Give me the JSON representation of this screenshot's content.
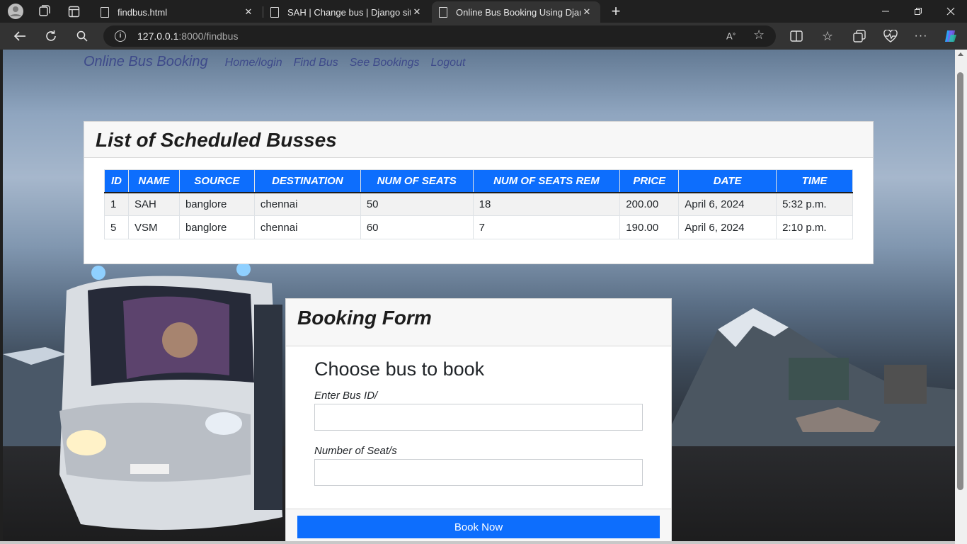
{
  "browser": {
    "tabs": [
      {
        "title": "findbus.html",
        "active": false
      },
      {
        "title": "SAH | Change bus | Django site admin",
        "active": false
      },
      {
        "title": "Online Bus Booking Using Django",
        "active": true
      }
    ],
    "new_tab_symbol": "+",
    "url_host": "127.0.0.1",
    "url_rest": ":8000/findbus",
    "icons": [
      "profile-icon",
      "workspaces-icon",
      "tab-actions-icon",
      "back-icon",
      "refresh-icon",
      "search-icon",
      "site-info-icon",
      "read-aloud-icon",
      "favorite-icon",
      "split-screen-icon",
      "favorites-icon",
      "collections-icon",
      "browser-essentials-icon",
      "more-icon",
      "copilot-icon"
    ]
  },
  "site": {
    "brand": "Online Bus Booking",
    "nav": [
      "Home/login",
      "Find Bus",
      "See Bookings",
      "Logout"
    ]
  },
  "bus_list": {
    "title": "List of Scheduled Busses",
    "headers": [
      "ID",
      "NAME",
      "SOURCE",
      "DESTINATION",
      "NUM OF SEATS",
      "NUM OF SEATS REM",
      "PRICE",
      "DATE",
      "TIME"
    ],
    "rows": [
      [
        "1",
        "SAH",
        "banglore",
        "chennai",
        "50",
        "18",
        "200.00",
        "April 6, 2024",
        "5:32 p.m."
      ],
      [
        "5",
        "VSM",
        "banglore",
        "chennai",
        "60",
        "7",
        "190.00",
        "April 6, 2024",
        "2:10 p.m."
      ]
    ]
  },
  "booking_form": {
    "title": "Booking Form",
    "heading": "Choose bus to book",
    "bus_id_label": "Enter Bus ID/",
    "seats_label": "Number of Seat/s",
    "bus_id_value": "",
    "seats_value": "",
    "submit_label": "Book Now"
  },
  "colors": {
    "primary": "#0d6efd",
    "nav_link": "#3e4a8a"
  }
}
